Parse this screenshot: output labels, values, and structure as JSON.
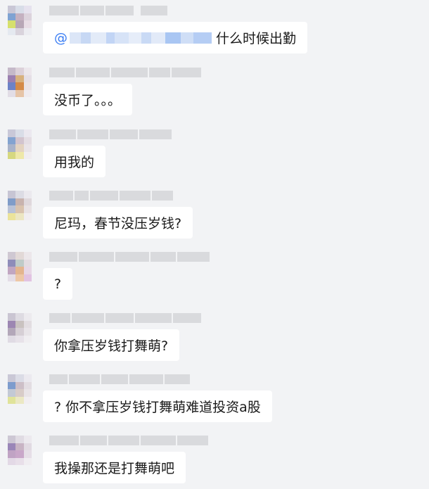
{
  "chat": {
    "messages": [
      {
        "text": "什么时候出勤",
        "mention_prefix": "@"
      },
      {
        "text": "没币了。。。"
      },
      {
        "text": "用我的"
      },
      {
        "text": "尼玛，春节没压岁钱?"
      },
      {
        "text": "?"
      },
      {
        "text": "你拿压岁钱打舞萌?"
      },
      {
        "text": "? 你不拿压岁钱打舞萌难道投资a股"
      },
      {
        "text": "我操那还是打舞萌吧"
      }
    ]
  },
  "colors": {
    "background": "#f2f3f5",
    "bubble": "#ffffff",
    "mention": "#3a7df3",
    "text": "#1a1a1a",
    "name_blur": "#d9dadd"
  }
}
